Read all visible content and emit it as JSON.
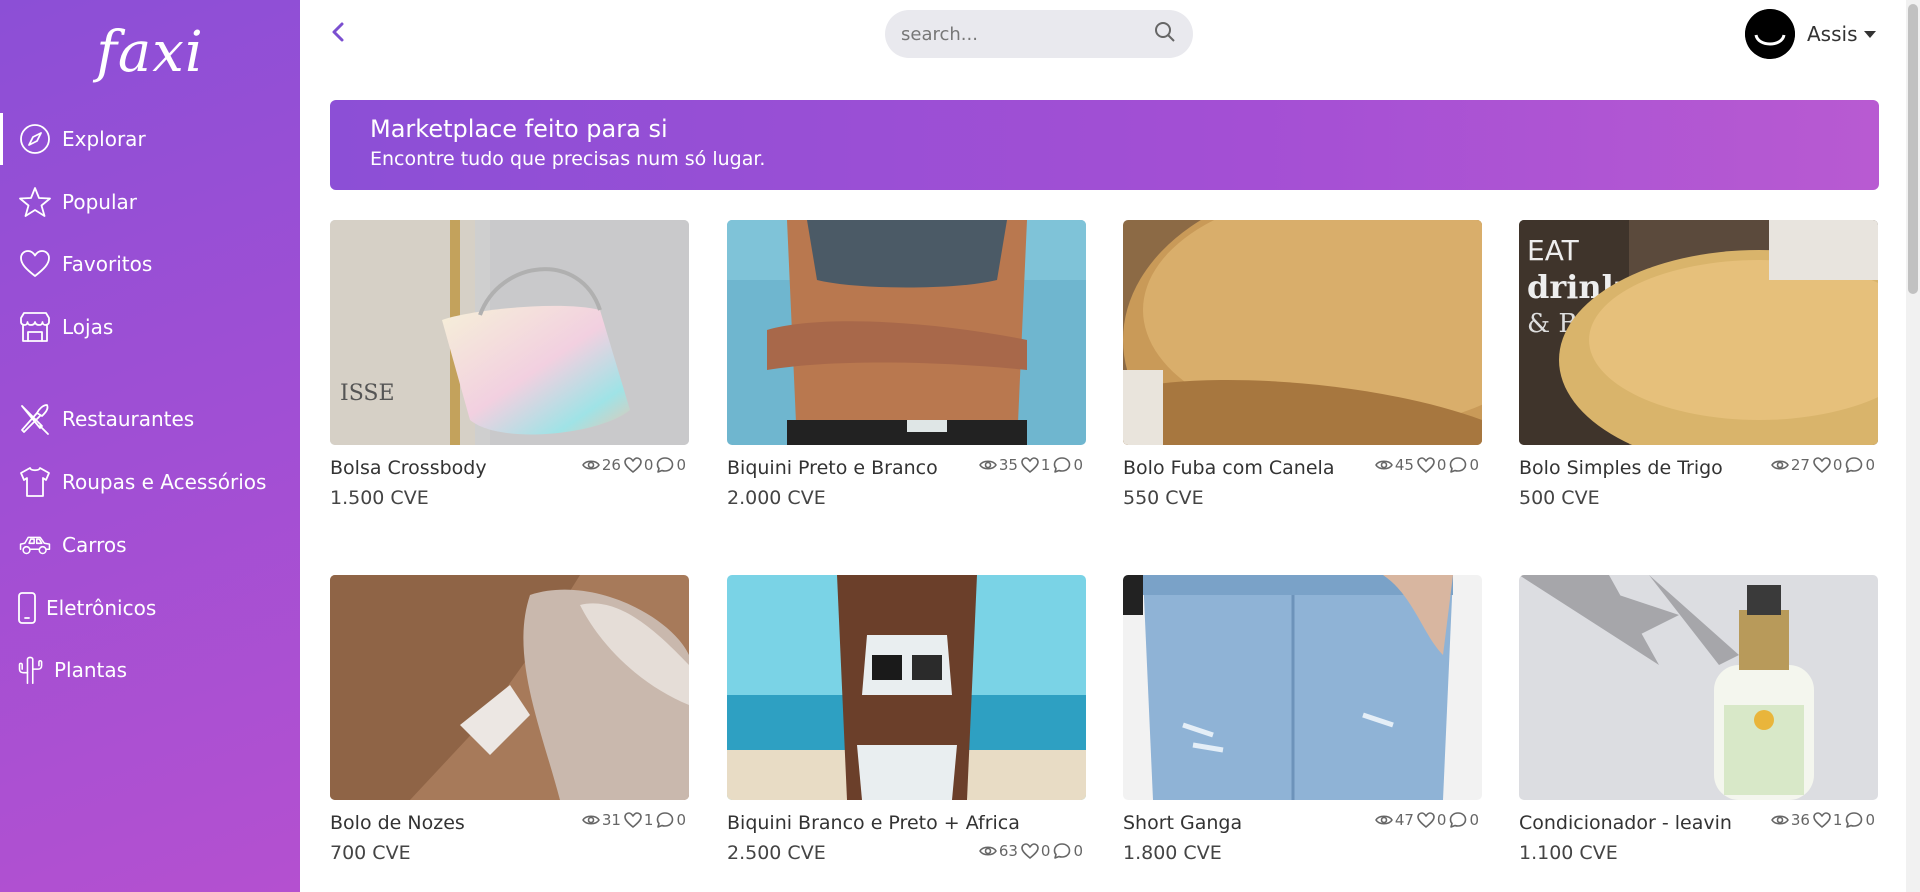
{
  "app": {
    "logo": "faxi"
  },
  "sidebar": {
    "items": [
      {
        "label": "Explorar",
        "icon": "compass-icon"
      },
      {
        "label": "Popular",
        "icon": "star-icon"
      },
      {
        "label": "Favoritos",
        "icon": "heart-icon"
      },
      {
        "label": "Lojas",
        "icon": "store-icon"
      },
      {
        "label": "Restaurantes",
        "icon": "utensils-icon"
      },
      {
        "label": "Roupas e Acessórios",
        "icon": "tshirt-icon"
      },
      {
        "label": "Carros",
        "icon": "car-icon"
      },
      {
        "label": "Eletrônicos",
        "icon": "phone-icon"
      },
      {
        "label": "Plantas",
        "icon": "cactus-icon"
      }
    ]
  },
  "header": {
    "search_placeholder": "search...",
    "user_name": "Assis"
  },
  "banner": {
    "title": "Marketplace feito para si",
    "subtitle": "Encontre tudo que precisas num só lugar."
  },
  "products": [
    {
      "name": "Bolsa Crossbody",
      "price": "1.500 CVE",
      "views": "26",
      "likes": "0",
      "comments": "0"
    },
    {
      "name": "Biquini Preto e Branco",
      "price": "2.000 CVE",
      "views": "35",
      "likes": "1",
      "comments": "0"
    },
    {
      "name": "Bolo Fuba com Canela",
      "price": "550 CVE",
      "views": "45",
      "likes": "0",
      "comments": "0"
    },
    {
      "name": "Bolo Simples de Trigo",
      "price": "500 CVE",
      "views": "27",
      "likes": "0",
      "comments": "0"
    },
    {
      "name": "Bolo de Nozes",
      "price": "700 CVE",
      "views": "31",
      "likes": "1",
      "comments": "0"
    },
    {
      "name": "Biquini Branco e Preto + Africa",
      "price": "2.500 CVE",
      "views": "63",
      "likes": "0",
      "comments": "0"
    },
    {
      "name": "Short Ganga",
      "price": "1.800 CVE",
      "views": "47",
      "likes": "0",
      "comments": "0"
    },
    {
      "name": "Condicionador - leavin",
      "price": "1.100 CVE",
      "views": "36",
      "likes": "1",
      "comments": "0"
    }
  ],
  "colors": {
    "accent": "#8c4fd6",
    "accent_end": "#b450d0"
  }
}
